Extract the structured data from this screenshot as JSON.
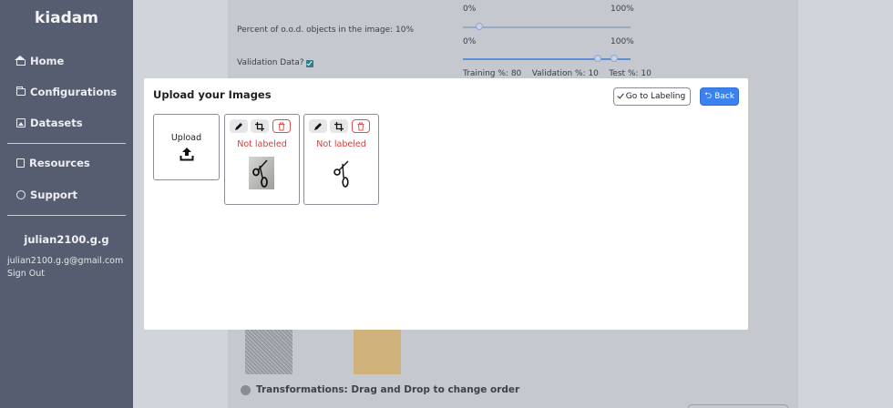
{
  "sidebar": {
    "brand": "kiadam",
    "items": [
      {
        "label": "Home",
        "icon": "home-icon"
      },
      {
        "label": "Configurations",
        "icon": "folder-icon"
      },
      {
        "label": "Datasets",
        "icon": "image-icon"
      },
      {
        "label": "Resources",
        "icon": "book-icon"
      },
      {
        "label": "Support",
        "icon": "chat-icon"
      }
    ],
    "user": {
      "name": "julian2100.g.g",
      "email": "julian2100.g.g@gmail.com",
      "signout": "Sign Out"
    }
  },
  "background": {
    "slider1_min": "0%",
    "slider1_max": "100%",
    "ood_label": "Percent of o.o.d. objects in the image: 10%",
    "slider2_min": "0%",
    "slider2_max": "100%",
    "validation_label": "Validation Data?",
    "split_text": "Training %: 80    Validation %: 10    Test %: 10",
    "transformations_label": "Transformations: Drag and Drop to change order"
  },
  "modal": {
    "title": "Upload your Images",
    "go_to_labeling": "Go to Labeling",
    "back": "Back",
    "upload_label": "Upload",
    "cards": [
      {
        "status": "Not labeled"
      },
      {
        "status": "Not labeled"
      }
    ]
  },
  "colors": {
    "sidebar_bg": "#565d70",
    "primary": "#3b82f0",
    "danger": "#d0433f"
  }
}
